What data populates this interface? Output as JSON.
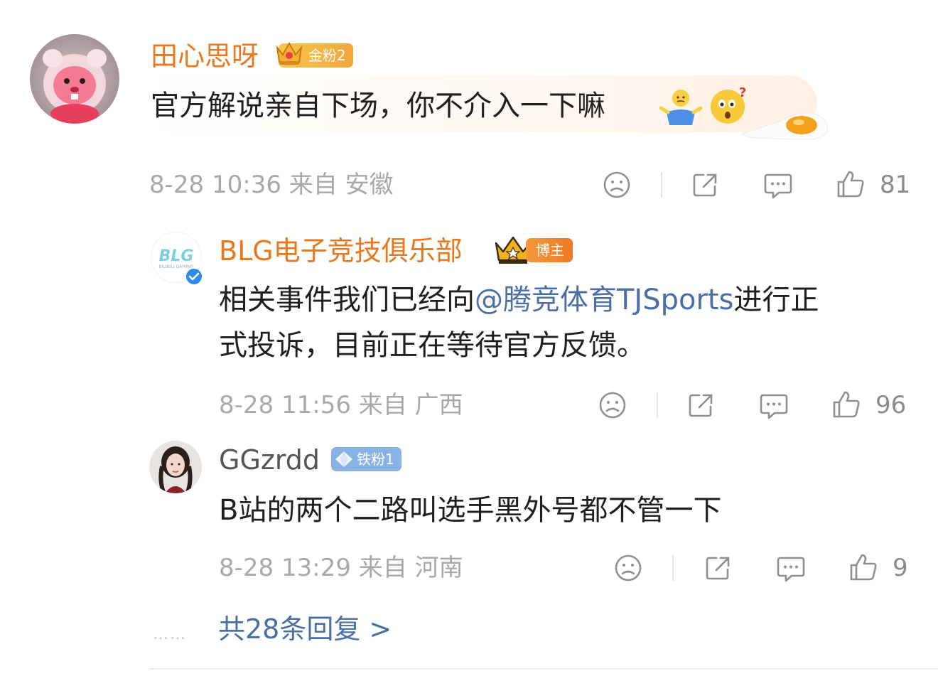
{
  "comment": {
    "author": "田心思呀",
    "badge_label": "金粉2",
    "text": "官方解说亲自下场，你不介入一下嘛",
    "emoji_1": "shrug-emoji",
    "emoji_2": "confused-emoji",
    "date": "8-28 10:36",
    "from_label": "来自",
    "location": "安徽",
    "likes": "81"
  },
  "replies": [
    {
      "author": "BLG电子竞技俱乐部",
      "badge_label": "博主",
      "text_line1_before": "相关事件我们已经向",
      "mention": "@腾竞体育TJSports",
      "text_line1_after": "进行正",
      "text_line2": "式投诉，目前正在等待官方反馈。",
      "date": "8-28 11:56",
      "from_label": "来自",
      "location": "广西",
      "likes": "96"
    },
    {
      "author": "GGzrdd",
      "badge_label": "铁粉1",
      "text": "B站的两个二路叫选手黑外号都不管一下",
      "date": "8-28 13:29",
      "from_label": "来自",
      "location": "河南",
      "likes": "9"
    }
  ],
  "more_replies_label": "共28条回复 >",
  "dots": "……",
  "icons": {
    "dislike": "frown-face-icon",
    "share": "share-icon",
    "comment": "comment-icon",
    "like": "thumbs-up-icon",
    "verified": "verified-check-icon",
    "crown": "crown-icon",
    "diamond": "diamond-icon"
  },
  "colors": {
    "name_orange": "#e8781e",
    "mention_blue": "#4a6fa5",
    "meta_gray": "#a8a8a8"
  }
}
